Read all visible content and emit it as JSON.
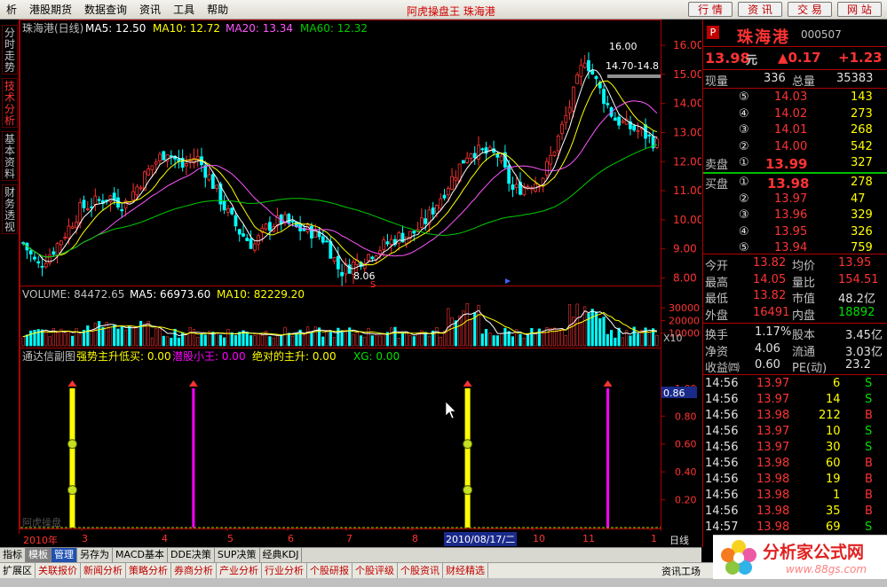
{
  "menu": {
    "items": [
      "析",
      "港股期货",
      "数据查询",
      "资讯",
      "工具",
      "帮助"
    ],
    "app_title": "阿虎操盘王  珠海港",
    "top_buttons": [
      "行 情",
      "资 讯",
      "交 易",
      "网 站"
    ]
  },
  "side_tabs": [
    "分时走势",
    "技术分析",
    "基本资料",
    "财务透视"
  ],
  "kline_header": {
    "name": "珠海港(日线)",
    "ma5": "MA5: 12.50",
    "ma10": "MA10: 12.72",
    "ma20": "MA20: 13.34",
    "ma60": "MA60: 12.32"
  },
  "price_axis": [
    "16.00",
    "15.00",
    "14.00",
    "13.00",
    "12.00",
    "11.00",
    "10.00",
    "9.00",
    "8.00"
  ],
  "annotations": {
    "high": "16.00",
    "low": "8.06",
    "range": "14.70-14.8"
  },
  "volume_header": {
    "volume": "VOLUME: 84472.65",
    "ma5": "MA5: 66973.60",
    "ma10": "MA10: 82229.20"
  },
  "volume_axis": [
    "30000",
    "20000",
    "10000"
  ],
  "volume_unit": "X10",
  "indicator_header": {
    "name": "通达信副图",
    "line1": "强势主升低买: 0.00",
    "line2": "潜股小王: 0.00",
    "line3": "绝对的主升: 0.00",
    "line4": "XG: 0.00"
  },
  "indicator_axis": [
    "1.00",
    "0.80",
    "0.60",
    "0.40",
    "0.20"
  ],
  "indicator_current": "0.86",
  "indicator_watermark": "阿虎操盘",
  "date_axis": {
    "year": "2010年",
    "months": [
      "3",
      "4",
      "5",
      "6",
      "7",
      "8",
      "10",
      "11",
      "1"
    ],
    "cursor_date": "2010/08/17/二",
    "period": "日线"
  },
  "bottom_tabs1": [
    "指标",
    "模板",
    "管理",
    "另存为",
    "MACD基本",
    "DDE决策",
    "SUP决策",
    "经典KDJ"
  ],
  "bottom_tabs2": [
    "扩展区",
    "关联报价",
    "新闻分析",
    "策略分析",
    "券商分析",
    "产业分析",
    "行业分析",
    "个股研报",
    "个股评级",
    "个股资讯",
    "财经精选"
  ],
  "bottom_right_label": "资讯工场",
  "quote": {
    "box_label": "P",
    "name": "珠海港",
    "code": "000507",
    "price": "13.98",
    "price_unit": "元",
    "change": "▲0.17",
    "change_pct": "+1.23",
    "now_label": "现量",
    "now_vol": "336",
    "total_label": "总量",
    "total_vol": "35383",
    "asks": [
      {
        "level": "⑤",
        "price": "14.03",
        "vol": "143"
      },
      {
        "level": "④",
        "price": "14.02",
        "vol": "273"
      },
      {
        "level": "③",
        "price": "14.01",
        "vol": "268"
      },
      {
        "level": "②",
        "price": "14.00",
        "vol": "542"
      },
      {
        "level": "①",
        "price": "13.99",
        "vol": "327"
      }
    ],
    "ask_label": "卖盘",
    "bid_label": "买盘",
    "bids": [
      {
        "level": "①",
        "price": "13.98",
        "vol": "278"
      },
      {
        "level": "②",
        "price": "13.97",
        "vol": "47"
      },
      {
        "level": "③",
        "price": "13.96",
        "vol": "329"
      },
      {
        "level": "④",
        "price": "13.95",
        "vol": "326"
      },
      {
        "level": "⑤",
        "price": "13.94",
        "vol": "759"
      }
    ],
    "stats": [
      {
        "l1": "今开",
        "v1": "13.82",
        "c1": "red",
        "l2": "均价",
        "v2": "13.95",
        "c2": "red"
      },
      {
        "l1": "最高",
        "v1": "14.05",
        "c1": "red",
        "l2": "量比",
        "v2": "154.51",
        "c2": "red"
      },
      {
        "l1": "最低",
        "v1": "13.82",
        "c1": "red",
        "l2": "市值",
        "v2": "48.2亿",
        "c2": "white"
      },
      {
        "l1": "外盘",
        "v1": "16491",
        "c1": "red",
        "l2": "内盘",
        "v2": "18892",
        "c2": "green"
      }
    ],
    "stats2": [
      {
        "l1": "换手",
        "v1": "1.17%",
        "l2": "股本",
        "v2": "3.45亿"
      },
      {
        "l1": "净资",
        "v1": "4.06",
        "l2": "流通",
        "v2": "3.03亿"
      },
      {
        "l1": "收益㈣",
        "v1": "0.60",
        "l2": "PE(动)",
        "v2": "23.2"
      }
    ],
    "ticks": [
      {
        "t": "14:56",
        "p": "13.97",
        "v": "6",
        "s": "S"
      },
      {
        "t": "14:56",
        "p": "13.97",
        "v": "14",
        "s": "S"
      },
      {
        "t": "14:56",
        "p": "13.98",
        "v": "212",
        "s": "B"
      },
      {
        "t": "14:56",
        "p": "13.97",
        "v": "10",
        "s": "S"
      },
      {
        "t": "14:56",
        "p": "13.97",
        "v": "30",
        "s": "S"
      },
      {
        "t": "14:56",
        "p": "13.98",
        "v": "60",
        "s": "B"
      },
      {
        "t": "14:56",
        "p": "13.98",
        "v": "19",
        "s": "B"
      },
      {
        "t": "14:56",
        "p": "13.98",
        "v": "1",
        "s": "B"
      },
      {
        "t": "14:56",
        "p": "13.98",
        "v": "35",
        "s": "B"
      },
      {
        "t": "14:57",
        "p": "13.98",
        "v": "69",
        "s": "S"
      }
    ]
  },
  "watermark": {
    "title": "分析家公式网",
    "url": "www.88gs.com"
  },
  "chart_data": {
    "type": "candlestick",
    "price_range": [
      7.8,
      16.4
    ],
    "approx_close_path": [
      9.2,
      8.4,
      8.9,
      9.6,
      10.4,
      10.6,
      10.8,
      10.5,
      11.2,
      11.9,
      12.4,
      11.8,
      12.2,
      11.4,
      10.4,
      9.6,
      9.1,
      9.8,
      10.0,
      9.7,
      9.6,
      9.3,
      8.2,
      8.5,
      8.8,
      9.1,
      9.4,
      9.5,
      10.0,
      10.8,
      11.6,
      12.4,
      12.3,
      12.2,
      11.0,
      11.2,
      11.4,
      12.6,
      14.0,
      15.6,
      14.5,
      13.5,
      13.2,
      13.0,
      12.6
    ],
    "ma_colors": {
      "ma5": "#ffffff",
      "ma10": "#ffff00",
      "ma20": "#ff55ff",
      "ma60": "#00cc00"
    },
    "indicator_spikes": [
      {
        "pos": 0.08,
        "color": "#ffff00",
        "value": 1.0
      },
      {
        "pos": 0.27,
        "color": "#ff00ff",
        "value": 1.0
      },
      {
        "pos": 0.7,
        "color": "#ffff00",
        "value": 1.0
      },
      {
        "pos": 0.92,
        "color": "#ff00ff",
        "value": 1.0
      }
    ]
  }
}
